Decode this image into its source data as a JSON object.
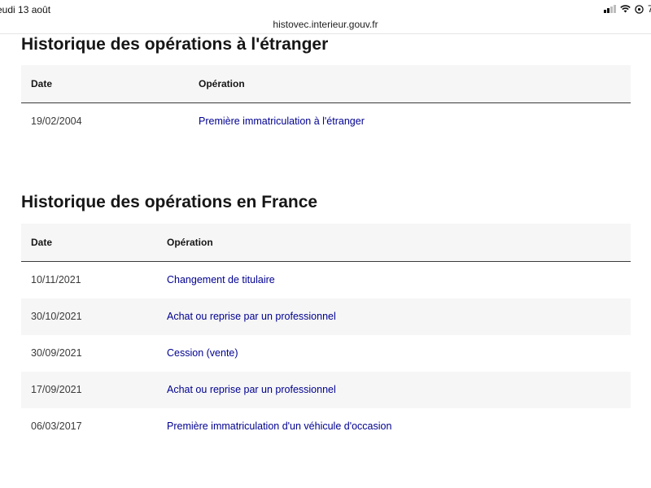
{
  "status_bar": {
    "date": "eudi 13 août",
    "battery_partial": "7:"
  },
  "browser": {
    "url": "histovec.interieur.gouv.fr"
  },
  "foreign_section": {
    "title": "Historique des opérations à l'étranger",
    "header": {
      "date": "Date",
      "operation": "Opération"
    },
    "rows": [
      {
        "date": "19/02/2004",
        "operation": "Première immatriculation à l'étranger"
      }
    ]
  },
  "france_section": {
    "title": "Historique des opérations en France",
    "header": {
      "date": "Date",
      "operation": "Opération"
    },
    "rows": [
      {
        "date": "10/11/2021",
        "operation": "Changement de titulaire"
      },
      {
        "date": "30/10/2021",
        "operation": "Achat ou reprise par un professionnel"
      },
      {
        "date": "30/09/2021",
        "operation": "Cession (vente)"
      },
      {
        "date": "17/09/2021",
        "operation": "Achat ou reprise par un professionnel"
      },
      {
        "date": "06/03/2017",
        "operation": "Première immatriculation d'un véhicule d'occasion"
      }
    ]
  },
  "colors": {
    "link": "#000091",
    "header_bg": "#f6f6f6",
    "text": "#161616"
  }
}
